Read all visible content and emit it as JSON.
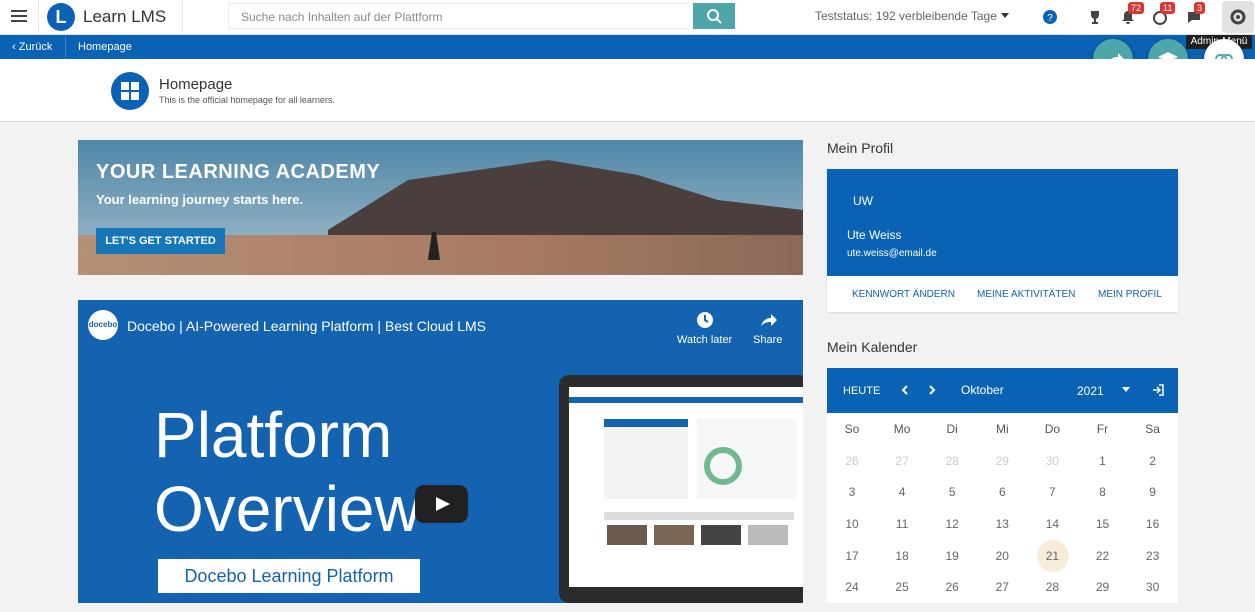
{
  "topbar": {
    "brand": "Learn LMS",
    "brand_letter": "L",
    "search_placeholder": "Suche nach Inhalten auf der Plattform",
    "trial_status": "Teststatus: 192 verbleibende Tage",
    "badges": {
      "notifications": "72",
      "coaching": "11",
      "messages": "3"
    },
    "admin_tooltip": "Admin-Menü"
  },
  "nav": {
    "back_label": "Zurück",
    "breadcrumb": "Homepage"
  },
  "page": {
    "title": "Homepage",
    "subtitle": "This is the official homepage for all learners."
  },
  "banner": {
    "title": "YOUR LEARNING ACADEMY",
    "subtitle": "Your learning journey starts here.",
    "button": "LET'S GET STARTED"
  },
  "video": {
    "logo_text": "docebo",
    "title": "Docebo | AI-Powered Learning Platform | Best Cloud LMS",
    "watch_later": "Watch later",
    "share": "Share",
    "big_line1": "Platform",
    "big_line2": "Overview",
    "label": "Docebo Learning Platform"
  },
  "profile": {
    "heading": "Mein Profil",
    "initials": "UW",
    "name": "Ute Weiss",
    "email": "ute.weiss@email.de",
    "links": [
      "KENNWORT ÄNDERN",
      "MEINE AKTIVITÄTEN",
      "MEIN PROFIL"
    ]
  },
  "calendar": {
    "heading": "Mein Kalender",
    "today_label": "HEUTE",
    "month": "Oktober",
    "year": "2021",
    "weekdays": [
      "So",
      "Mo",
      "Di",
      "Mi",
      "Do",
      "Fr",
      "Sa"
    ],
    "weeks": [
      [
        "26",
        "27",
        "28",
        "29",
        "30",
        "1",
        "2"
      ],
      [
        "3",
        "4",
        "5",
        "6",
        "7",
        "8",
        "9"
      ],
      [
        "10",
        "11",
        "12",
        "13",
        "14",
        "15",
        "16"
      ],
      [
        "17",
        "18",
        "19",
        "20",
        "21",
        "22",
        "23"
      ],
      [
        "24",
        "25",
        "26",
        "27",
        "28",
        "29",
        "30"
      ]
    ],
    "today": "21",
    "colors": {
      "primary": "#0a62b5",
      "accent": "#4fa6a8"
    }
  }
}
